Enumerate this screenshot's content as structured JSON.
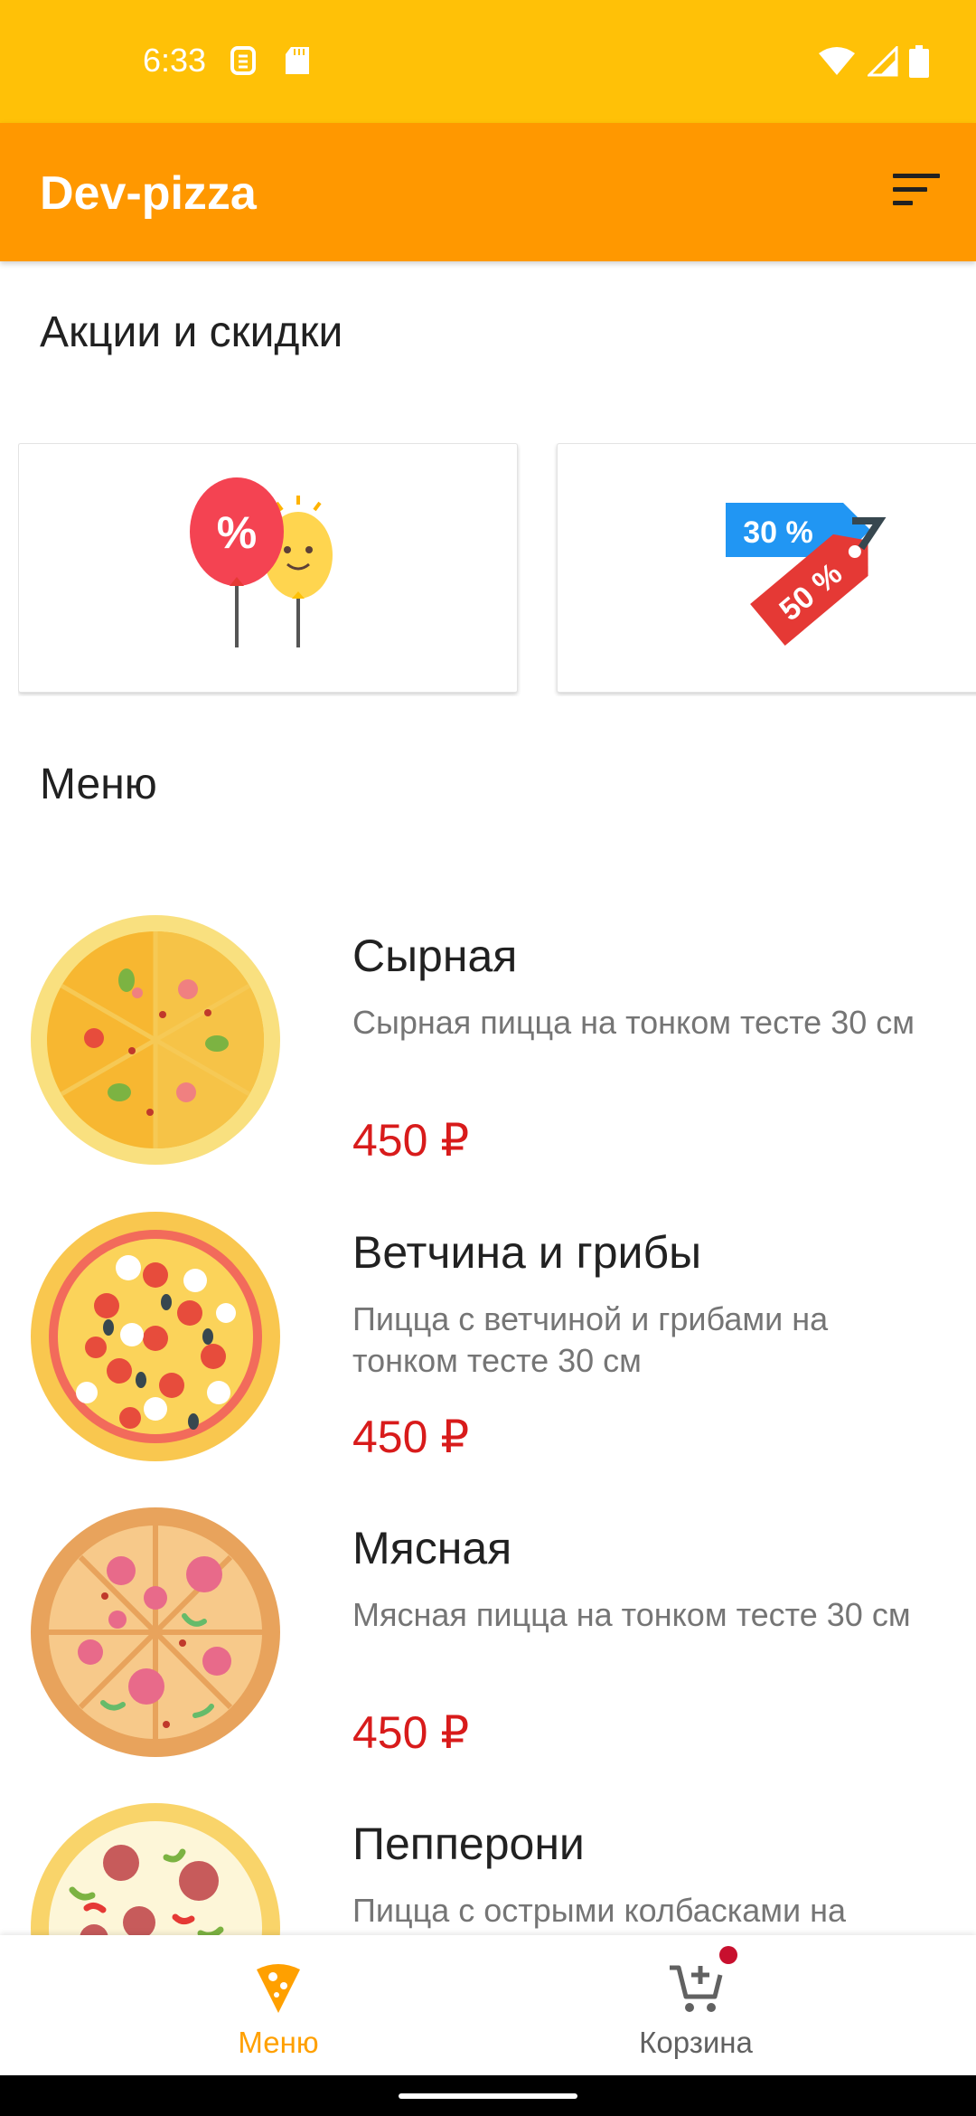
{
  "status_bar": {
    "time": "6:33",
    "icons": [
      "sim-icon",
      "sd-card-icon",
      "wifi-icon",
      "signal-icon",
      "battery-icon"
    ],
    "color": "#FFC107"
  },
  "app_bar": {
    "title": "Dev-pizza",
    "color": "#FF9800",
    "menu_icon": "sort-icon"
  },
  "promotions": {
    "title": "Акции и скидки",
    "cards": [
      {
        "icon": "balloons-percent-icon"
      },
      {
        "icon": "discount-tags-icon",
        "tag_texts": [
          "30 %",
          "50 %"
        ]
      }
    ]
  },
  "menu": {
    "title": "Меню",
    "items": [
      {
        "name": "Сырная",
        "description": "Сырная пицца на тонком тесте 30 см",
        "price": "450 ₽",
        "icon": "cheese-pizza-icon"
      },
      {
        "name": "Ветчина и грибы",
        "description": "Пицца с ветчиной и грибами на тонком тесте 30 см",
        "price": "450 ₽",
        "icon": "ham-mushroom-pizza-icon"
      },
      {
        "name": "Мясная",
        "description": "Мясная пицца на тонком тесте 30 см",
        "price": "450 ₽",
        "icon": "meat-pizza-icon"
      },
      {
        "name": "Пепперони",
        "description": "Пицца с острыми колбасками на",
        "price": "",
        "icon": "pepperoni-pizza-icon"
      }
    ]
  },
  "bottom_nav": {
    "items": [
      {
        "label": "Меню",
        "icon": "pizza-slice-icon",
        "active": true
      },
      {
        "label": "Корзина",
        "icon": "cart-add-icon",
        "active": false
      }
    ],
    "active_color": "#FFA000",
    "inactive_color": "#616161",
    "badge_color": "#C8102E"
  }
}
